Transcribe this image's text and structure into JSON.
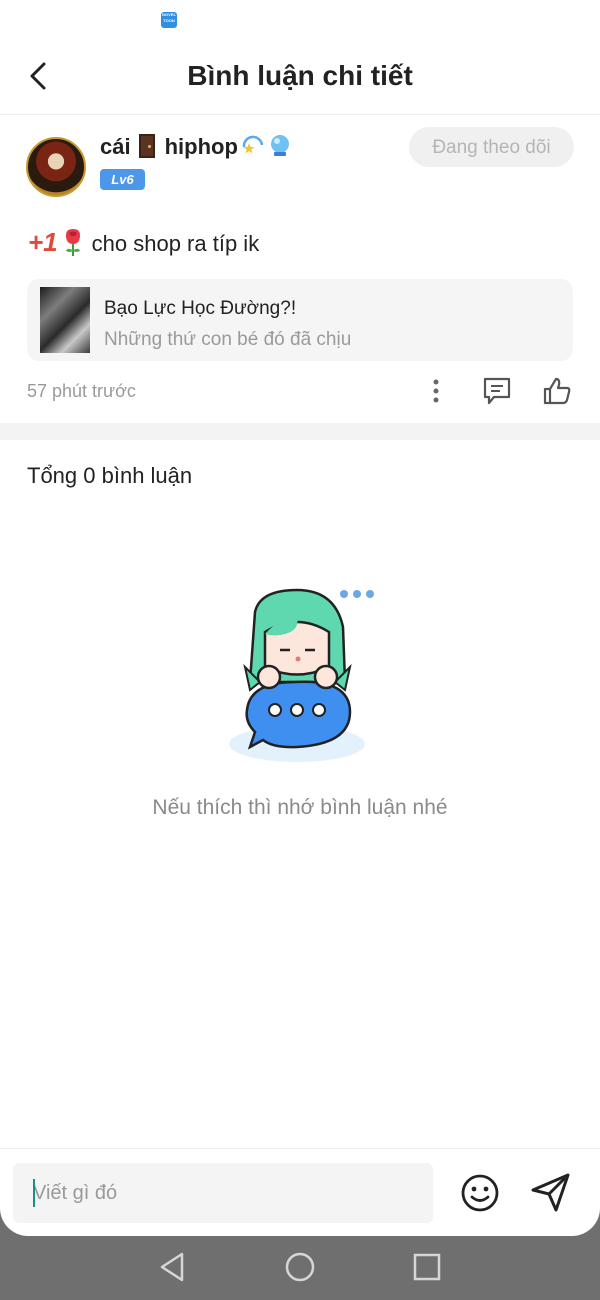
{
  "status_bar": {
    "app_icon_text": "NOVEL TOON"
  },
  "header": {
    "title": "Bình luận chi tiết"
  },
  "post": {
    "user_name": "cái",
    "user_name_suffix": "hiphop",
    "level": "Lv6",
    "follow_label": "Đang theo dõi",
    "plus_one": "+1",
    "text": "cho shop ra típ ik",
    "book_title": "Bạo Lực Học Đường?!",
    "book_subtitle": "Những thứ con bé đó đã chịu",
    "time": "57 phút trước"
  },
  "comments": {
    "count_label": "Tổng 0 bình luận",
    "empty_message": "Nếu thích thì nhớ bình luận nhé"
  },
  "input": {
    "placeholder": "Viết gì đó"
  },
  "icons": [
    "back-arrow-icon",
    "door-icon",
    "sparkle-icon",
    "orb-icon",
    "rose-icon",
    "more-icon",
    "comment-icon",
    "like-icon",
    "emoji-icon",
    "send-icon"
  ],
  "colors": {
    "accent_blue": "#4d97e9",
    "follow_bg": "#f0f0f0",
    "illustration_hair": "#5fd8b0",
    "illustration_bubble": "#3e8ff0"
  }
}
